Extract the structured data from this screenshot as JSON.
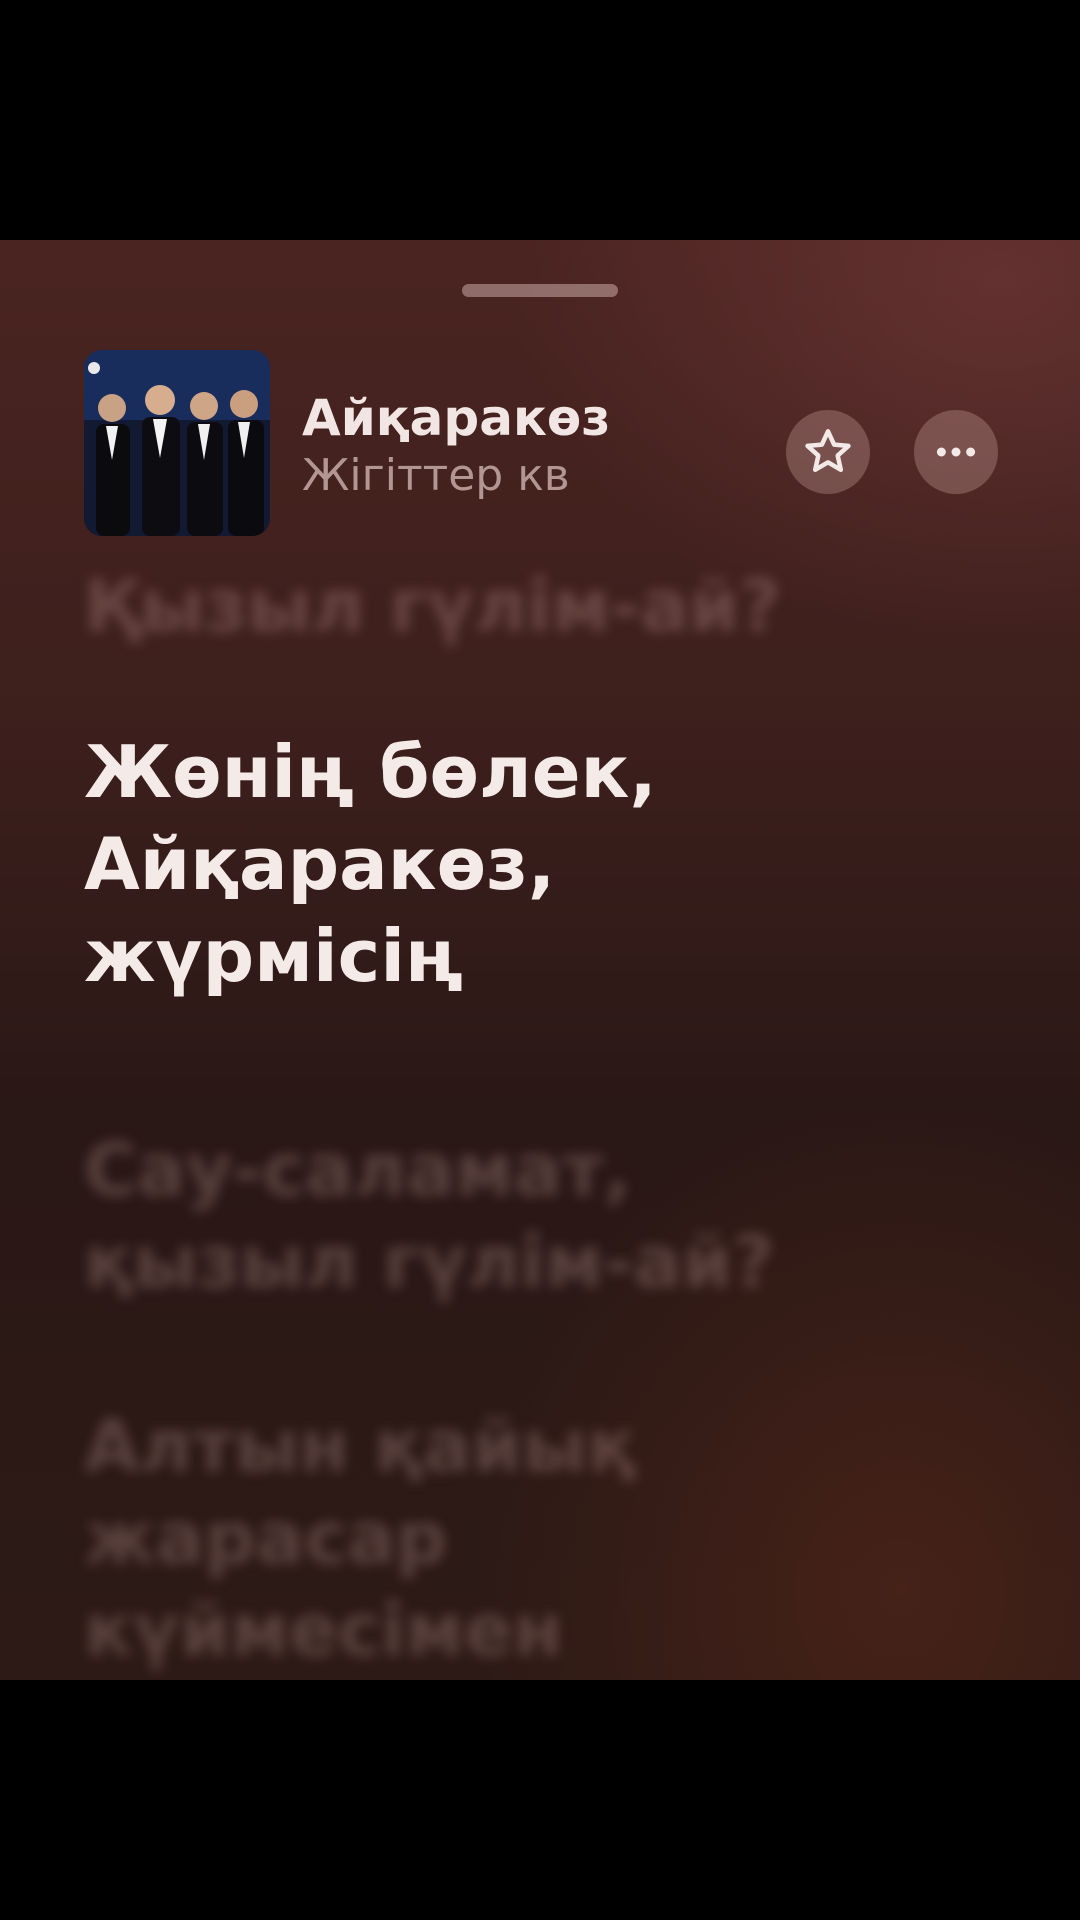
{
  "now_playing": {
    "title": "Айқаракөз",
    "artist": "Жігіттер кв"
  },
  "buttons": {
    "favorite_icon": "star-icon",
    "more_icon": "ellipsis-icon"
  },
  "lyrics": {
    "prev_line": "Қызыл гүлім-ай?",
    "current_line": "Жөнің бөлек,\nАйқаракөз,\nжүрмісің",
    "next_line": "Сау-саламат,\nқызыл гүлім-ай?",
    "next_line_2": "Алтын қайық\nжарасар\nкүймесімен"
  },
  "colors": {
    "background": "#3c1f1c",
    "current_lyric": "#f4ebe8",
    "dim_lyric": "#d2aaa5"
  }
}
